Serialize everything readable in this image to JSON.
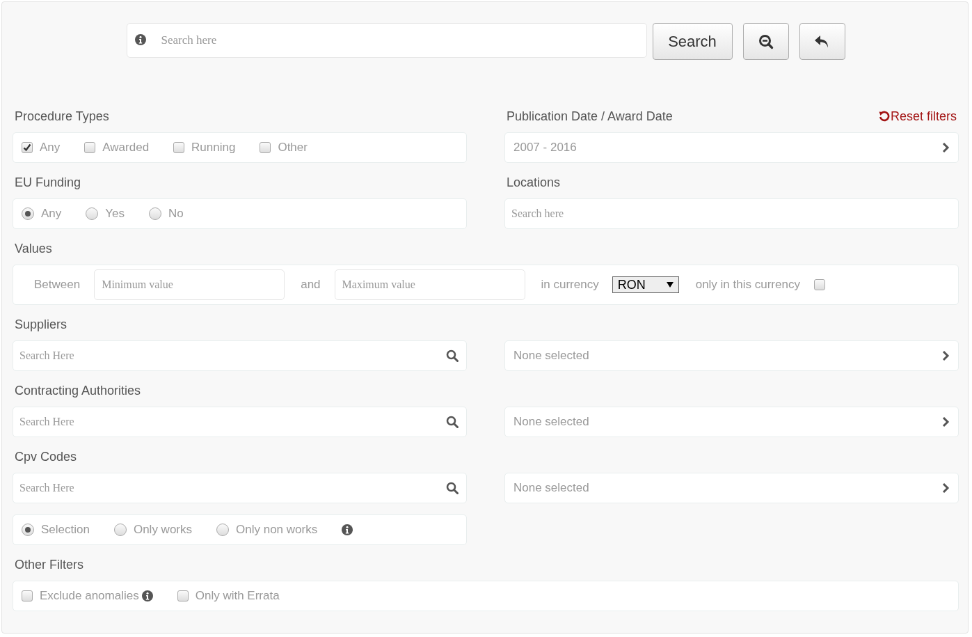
{
  "search": {
    "placeholder": "Search here",
    "button": "Search"
  },
  "procedure_types": {
    "title": "Procedure Types",
    "options": [
      {
        "label": "Any",
        "checked": true
      },
      {
        "label": "Awarded",
        "checked": false
      },
      {
        "label": "Running",
        "checked": false
      },
      {
        "label": "Other",
        "checked": false
      }
    ]
  },
  "publication_date": {
    "title": "Publication Date / Award Date",
    "value": "2007 - 2016"
  },
  "reset_filters": "Reset filters",
  "eu_funding": {
    "title": "EU Funding",
    "options": [
      {
        "label": "Any",
        "selected": true
      },
      {
        "label": "Yes",
        "selected": false
      },
      {
        "label": "No",
        "selected": false
      }
    ]
  },
  "locations": {
    "title": "Locations",
    "placeholder": "Search here"
  },
  "values": {
    "title": "Values",
    "between": "Between",
    "min_placeholder": "Minimum value",
    "and": "and",
    "max_placeholder": "Maximum value",
    "in_currency": "in currency",
    "currency": "RON",
    "only_label": "only in this currency",
    "only_checked": false
  },
  "suppliers": {
    "title": "Suppliers",
    "placeholder": "Search Here",
    "selection": "None selected"
  },
  "contracting_authorities": {
    "title": "Contracting Authorities",
    "placeholder": "Search Here",
    "selection": "None selected"
  },
  "cpv_codes": {
    "title": "Cpv Codes",
    "placeholder": "Search Here",
    "selection": "None selected"
  },
  "cpv_scope": [
    {
      "label": "Selection",
      "selected": true
    },
    {
      "label": "Only works",
      "selected": false
    },
    {
      "label": "Only non works",
      "selected": false
    }
  ],
  "other_filters": {
    "title": "Other Filters",
    "options": [
      {
        "label": "Exclude anomalies",
        "checked": false,
        "info": true
      },
      {
        "label": "Only with Errata",
        "checked": false,
        "info": false
      }
    ]
  }
}
